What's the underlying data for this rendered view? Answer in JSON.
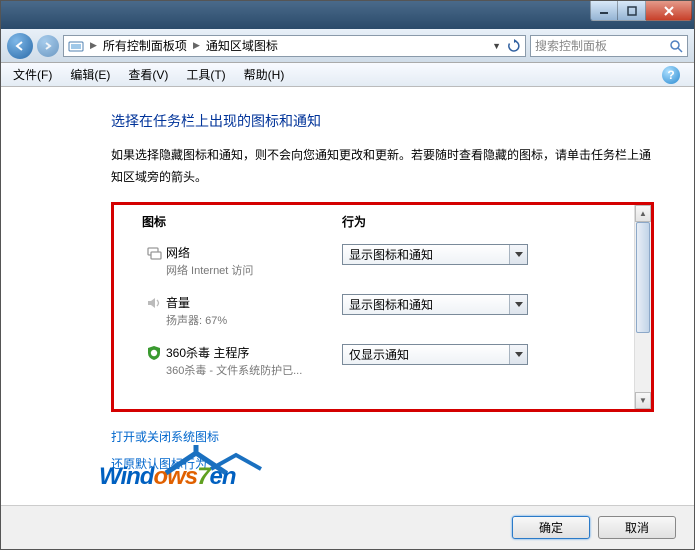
{
  "breadcrumb": {
    "seg1": "所有控制面板项",
    "seg2": "通知区域图标"
  },
  "search": {
    "placeholder": "搜索控制面板"
  },
  "menu": {
    "file": "文件(F)",
    "edit": "编辑(E)",
    "view": "查看(V)",
    "tools": "工具(T)",
    "help": "帮助(H)"
  },
  "heading": "选择在任务栏上出现的图标和通知",
  "description": "如果选择隐藏图标和通知，则不会向您通知更改和更新。若要随时查看隐藏的图标，请单击任务栏上通知区域旁的箭头。",
  "columns": {
    "icon": "图标",
    "behavior": "行为"
  },
  "rows": [
    {
      "title": "网络",
      "sub": "网络 Internet 访问",
      "value": "显示图标和通知"
    },
    {
      "title": "音量",
      "sub": "扬声器: 67%",
      "value": "显示图标和通知"
    },
    {
      "title": "360杀毒 主程序",
      "sub": "360杀毒 - 文件系统防护已...",
      "value": "仅显示通知"
    }
  ],
  "links": {
    "system": "打开或关闭系统图标",
    "restore": "还原默认图标行为"
  },
  "buttons": {
    "ok": "确定",
    "cancel": "取消"
  },
  "logo": {
    "text_w": "W",
    "text_ind": "ind",
    "text_ows": "ows",
    "text_7": "7",
    "text_en": "en"
  }
}
